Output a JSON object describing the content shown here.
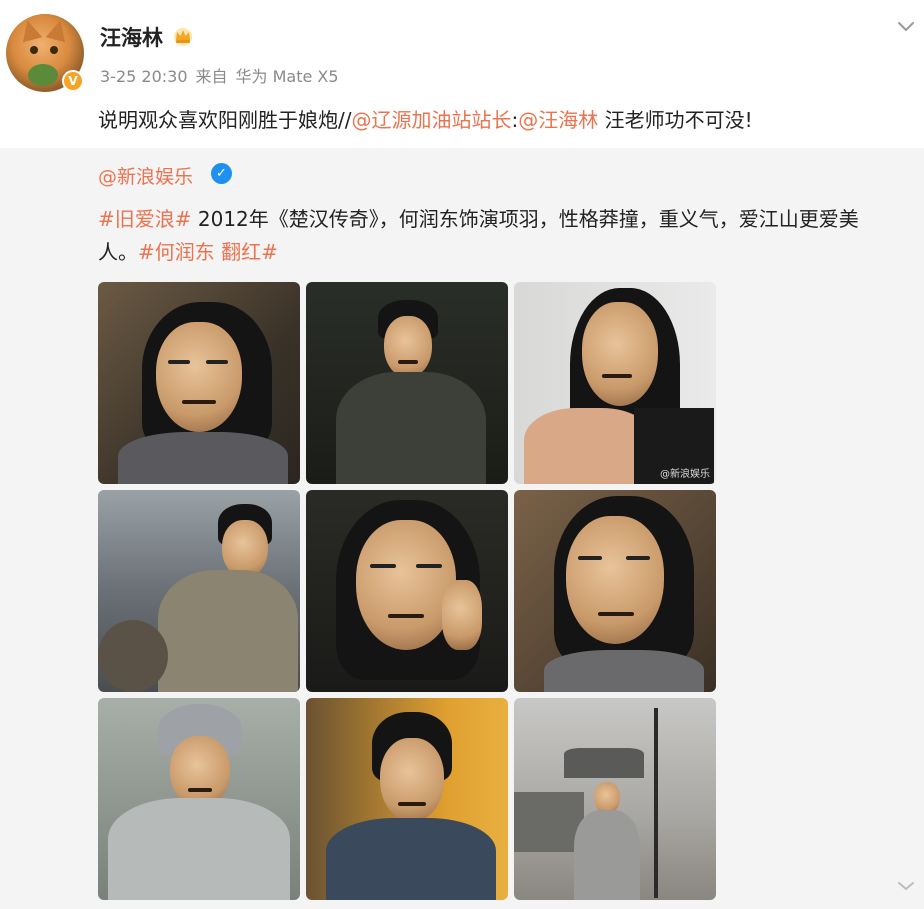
{
  "post": {
    "username": "汪海林",
    "time": "3-25 20:30",
    "source_prefix": "来自",
    "source_device": "华为 Mate X5",
    "text_a": "说明观众喜欢阳刚胜于娘炮//",
    "mention_1": "@辽源加油站站长",
    "text_b": ":",
    "mention_2": "@汪海林",
    "text_c": " 汪老师功不可没!",
    "verified_badge": "V"
  },
  "repost": {
    "author": "@新浪娱乐",
    "verified_badge": "✓",
    "hashtag_1": "#旧爱浪#",
    "line1_text": " 2012年《楚汉传奇》，何润东饰演项羽，性格莽撞，重义气，爱江山更爱美",
    "line2_text": "人。",
    "hashtag_2": "#何润东 翻红#",
    "watermark": "@新浪娱乐",
    "images": [
      {
        "name": "photo-1"
      },
      {
        "name": "photo-2"
      },
      {
        "name": "photo-3"
      },
      {
        "name": "photo-4"
      },
      {
        "name": "photo-5"
      },
      {
        "name": "photo-6"
      },
      {
        "name": "photo-7"
      },
      {
        "name": "photo-8"
      },
      {
        "name": "photo-9"
      }
    ]
  },
  "icons": {
    "crown": "crown-icon",
    "chevron": "chevron-down-icon",
    "expand": "expand-icon"
  },
  "colors": {
    "mention": "#eb7350",
    "repost_bg": "#f4f4f4",
    "gold_badge": "#f7a326",
    "blue_badge": "#1f8ff0"
  }
}
